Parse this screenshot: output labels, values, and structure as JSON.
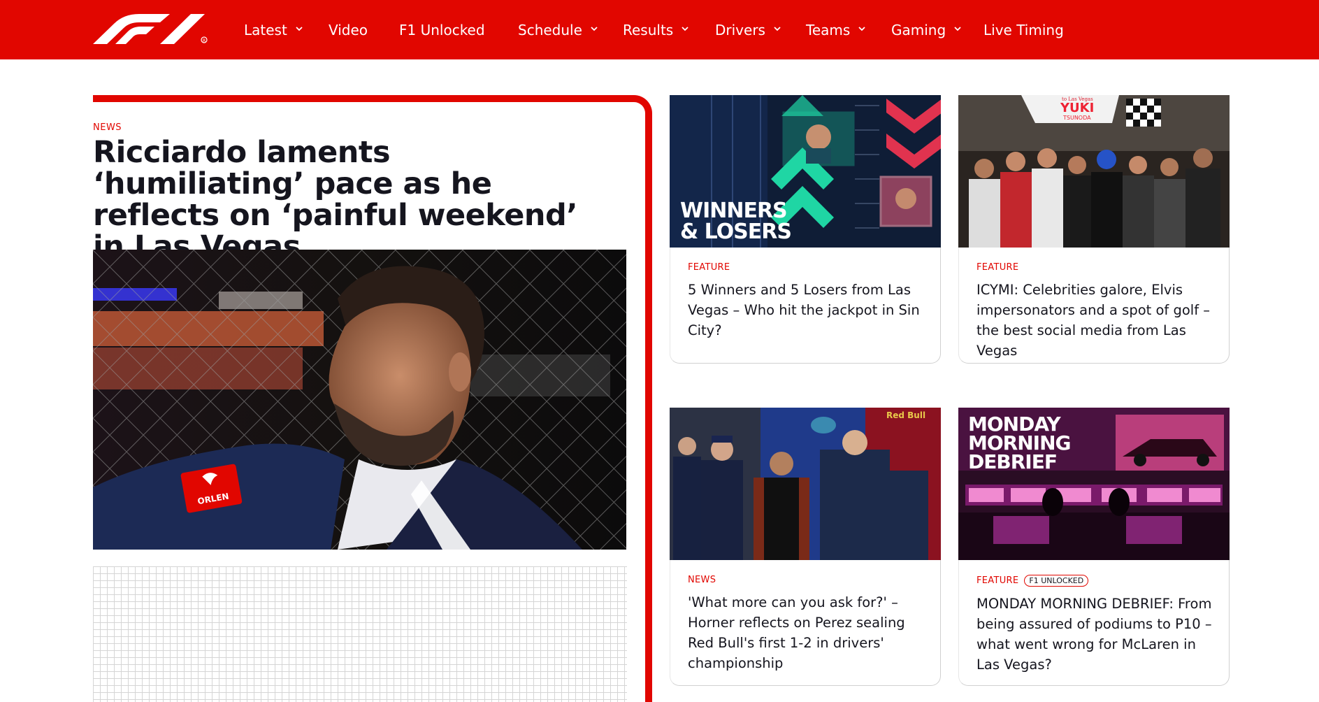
{
  "nav": {
    "brand": "F1",
    "items": [
      {
        "label": "Latest",
        "dropdown": true
      },
      {
        "label": "Video",
        "dropdown": false
      },
      {
        "label": "F1 Unlocked",
        "dropdown": false
      },
      {
        "label": "Schedule",
        "dropdown": true
      },
      {
        "label": "Results",
        "dropdown": true
      },
      {
        "label": "Drivers",
        "dropdown": true
      },
      {
        "label": "Teams",
        "dropdown": true
      },
      {
        "label": "Gaming",
        "dropdown": true
      },
      {
        "label": "Live Timing",
        "dropdown": false
      }
    ]
  },
  "colors": {
    "brand_red": "#e10600",
    "text_dark": "#15151e"
  },
  "featured": {
    "tag": "NEWS",
    "title": "Ricciardo laments ‘humiliating’ pace as he reflects on ‘painful weekend’ in Las Vegas",
    "image_icon": "driver-portrait-image",
    "image_text": "ORLEN"
  },
  "cards": [
    {
      "tag": "FEATURE",
      "title": "5 Winners and 5 Losers from Las Vegas – Who hit the jackpot in Sin City?",
      "thumb_text": [
        "WINNERS",
        "& LOSERS"
      ],
      "thumb_icon": "winners-losers-graphic"
    },
    {
      "tag": "FEATURE",
      "title": "ICYMI: Celebrities galore, Elvis impersonators and a spot of golf – the best social media from Las Vegas",
      "thumb_text": [
        "to Las Vegas",
        "YUKI",
        "TSUNODA"
      ],
      "thumb_icon": "celebrities-photo"
    },
    {
      "tag": "NEWS",
      "title": "'What more can you ask for?' – Horner reflects on Perez sealing Red Bull's first 1-2 in drivers' championship",
      "thumb_text": [
        "Red Bull"
      ],
      "thumb_icon": "red-bull-team-photo"
    },
    {
      "tag": "FEATURE",
      "badge": "F1 UNLOCKED",
      "title": "MONDAY MORNING DEBRIEF: From being assured of podiums to P10 – what went wrong for McLaren in Las Vegas?",
      "thumb_text": [
        "MONDAY",
        "MORNING",
        "DEBRIEF"
      ],
      "thumb_icon": "debrief-graphic"
    }
  ]
}
